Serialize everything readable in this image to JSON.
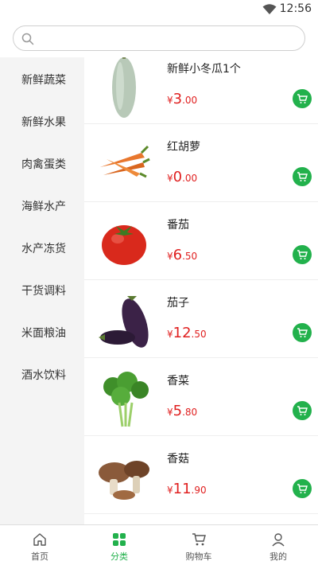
{
  "status": {
    "time": "12:56"
  },
  "search": {
    "placeholder": ""
  },
  "sidebar": {
    "items": [
      {
        "label": "新鲜蔬菜"
      },
      {
        "label": "新鲜水果"
      },
      {
        "label": "肉禽蛋类"
      },
      {
        "label": "海鲜水产"
      },
      {
        "label": "水产冻货"
      },
      {
        "label": "干货调料"
      },
      {
        "label": "米面粮油"
      },
      {
        "label": "酒水饮料"
      }
    ]
  },
  "products": [
    {
      "name": "新鲜小冬瓜1个",
      "currency": "¥",
      "price_int": "3",
      "price_dec": ".00",
      "icon": "winter-melon"
    },
    {
      "name": "红胡萝",
      "currency": "¥",
      "price_int": "0",
      "price_dec": ".00",
      "icon": "carrot"
    },
    {
      "name": "番茄",
      "currency": "¥",
      "price_int": "6",
      "price_dec": ".50",
      "icon": "tomato"
    },
    {
      "name": "茄子",
      "currency": "¥",
      "price_int": "12",
      "price_dec": ".50",
      "icon": "eggplant"
    },
    {
      "name": "香菜",
      "currency": "¥",
      "price_int": "5",
      "price_dec": ".80",
      "icon": "coriander"
    },
    {
      "name": "香菇",
      "currency": "¥",
      "price_int": "11",
      "price_dec": ".90",
      "icon": "mushroom"
    }
  ],
  "tabbar": {
    "tabs": [
      {
        "label": "首页",
        "icon": "home-icon"
      },
      {
        "label": "分类",
        "icon": "category-icon"
      },
      {
        "label": "购物车",
        "icon": "cart-icon"
      },
      {
        "label": "我的",
        "icon": "user-icon"
      }
    ]
  },
  "colors": {
    "accent": "#22b14c",
    "price": "#e02020"
  }
}
